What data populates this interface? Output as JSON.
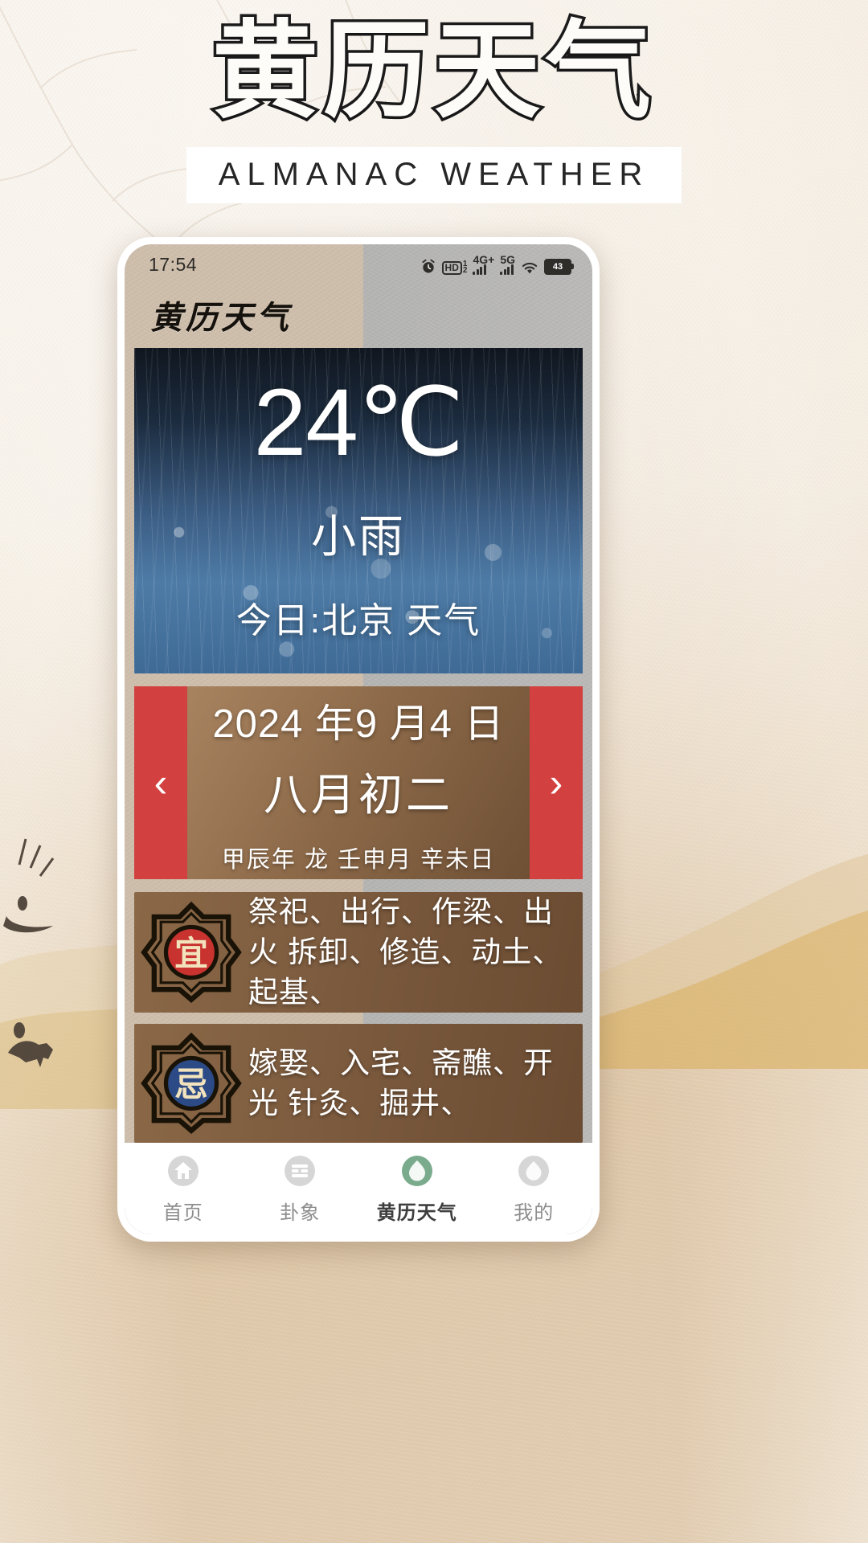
{
  "poster": {
    "title_cn": "黄历天气",
    "title_en": "ALMANAC WEATHER"
  },
  "phone": {
    "statusbar": {
      "time": "17:54",
      "icons": [
        {
          "name": "alarm-icon",
          "label": "⏰"
        },
        {
          "name": "hd-voice-icon",
          "label": "HD"
        },
        {
          "name": "hd-slot-sup",
          "label": "1"
        },
        {
          "name": "hd-slot-sub",
          "label": "2"
        },
        {
          "name": "signal-4g-icon",
          "label": "4G+"
        },
        {
          "name": "signal-5g-icon",
          "label": "5G"
        },
        {
          "name": "wifi-icon",
          "label": "wifi"
        },
        {
          "name": "battery-icon",
          "label": "43"
        }
      ],
      "battery_level": "43",
      "network_4g": "4G+",
      "network_5g": "5G"
    },
    "app_logo": "黄历天气",
    "weather": {
      "temperature": "24℃",
      "condition": "小雨",
      "location_line": "今日:北京 天气"
    },
    "date_card": {
      "prev_label": "‹",
      "next_label": "›",
      "solar": "2024 年9 月4 日",
      "lunar": "八月初二",
      "ganzhi": "甲辰年 龙 壬申月 辛未日"
    },
    "advice": [
      {
        "seal": "宜",
        "seal_color": "#c8332f",
        "text": "祭祀、出行、作梁、出火 拆卸、修造、动土、起基、"
      },
      {
        "seal": "忌",
        "seal_color": "#2b4a86",
        "text": "嫁娶、入宅、斋醮、开光 针灸、掘井、"
      }
    ],
    "tabbar": [
      {
        "label": "首页",
        "icon": "home-icon",
        "active": false
      },
      {
        "label": "卦象",
        "icon": "hexagram-icon",
        "active": false
      },
      {
        "label": "黄历天气",
        "icon": "almanac-weather-icon",
        "active": true
      },
      {
        "label": "我的",
        "icon": "profile-icon",
        "active": false
      }
    ],
    "accent_colors": {
      "nav_arrow_red": "#d2413f",
      "active_tab_green": "#7aab8c",
      "card_brown": "#7c5c3e"
    }
  }
}
